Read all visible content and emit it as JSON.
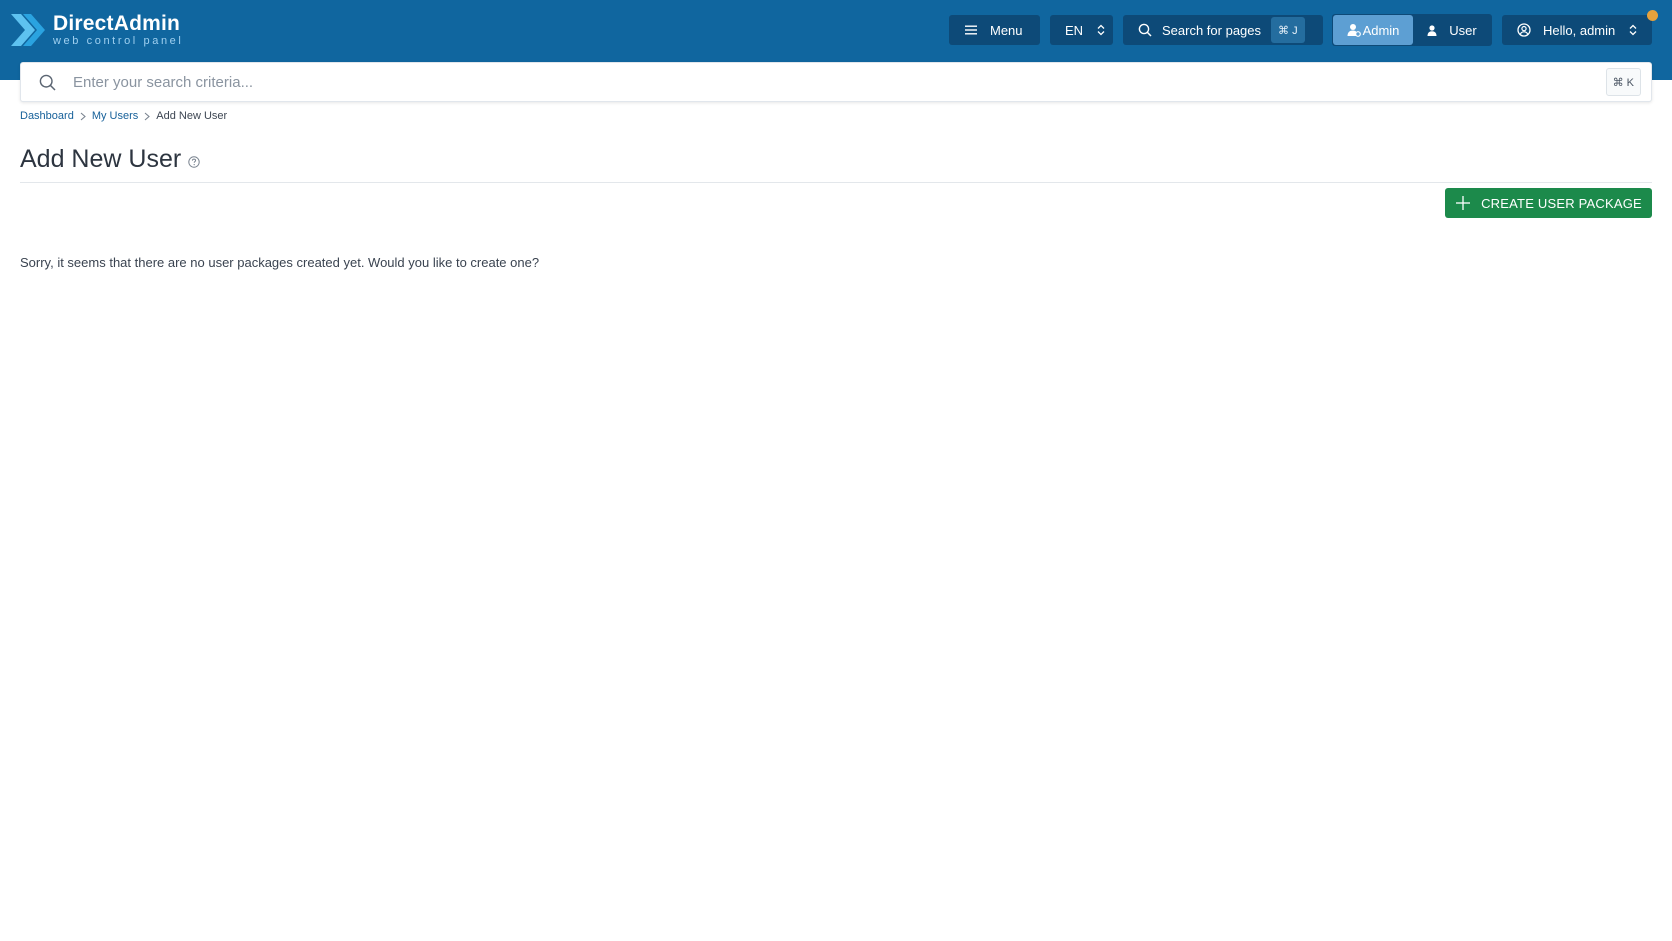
{
  "brand": {
    "title": "DirectAdmin",
    "subtitle": "web control panel"
  },
  "header": {
    "menu_label": "Menu",
    "language": "EN",
    "search_pages_label": "Search for pages",
    "search_pages_shortcut": "⌘ J",
    "roles": {
      "admin": "Admin",
      "user": "User",
      "active": "admin"
    },
    "greeting": "Hello, admin"
  },
  "search": {
    "placeholder": "Enter your search criteria...",
    "value": "",
    "shortcut": "⌘ K"
  },
  "breadcrumb": [
    {
      "label": "Dashboard"
    },
    {
      "label": "My Users"
    },
    {
      "label": "Add New User"
    }
  ],
  "page": {
    "title": "Add New User",
    "create_button": "CREATE USER PACKAGE",
    "message": "Sorry, it seems that there are no user packages created yet. Would you like to create one?"
  },
  "colors": {
    "header_bg": "#10669f",
    "header_button_bg": "#0d4a78",
    "active_role_bg": "#5d9fd3",
    "create_button_bg": "#1c8a4b",
    "notification_dot": "#e6a23c",
    "link": "#17619a"
  },
  "icons": {
    "logo": "directadmin-chevron-logo",
    "menu": "hamburger-icon",
    "language_select": "updown-chevron-icon",
    "search": "search-icon",
    "admin_role": "user-gear-icon",
    "user_role": "user-icon",
    "account": "user-circle-icon",
    "help": "help-circle-icon",
    "create": "plus-icon",
    "breadcrumb_separator": "chevron-right-icon"
  }
}
